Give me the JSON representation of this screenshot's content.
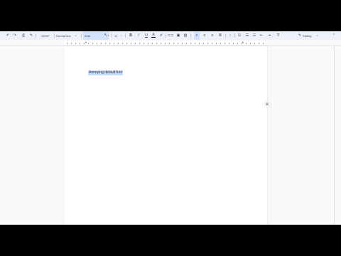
{
  "toolbar": {
    "zoom": "100%",
    "style": "Normal text",
    "font": "Arial",
    "font_size": "11",
    "editing_label": "Editing",
    "icons": [
      "undo-icon",
      "redo-icon",
      "print-icon",
      "paint-format-icon",
      "bold-icon",
      "italic-icon",
      "underline-icon",
      "text-color-icon",
      "highlight-icon",
      "link-icon",
      "add-comment-icon",
      "image-icon",
      "align-left-icon",
      "align-center-icon",
      "align-right-icon",
      "justify-icon",
      "line-spacing-icon",
      "checklist-icon",
      "bulleted-list-icon",
      "numbered-list-icon",
      "decrease-indent-icon",
      "increase-indent-icon",
      "clear-formatting-icon",
      "pencil-icon",
      "collapse-icon"
    ]
  },
  "document": {
    "selected_text": "Annoying default font"
  },
  "colors": {
    "toolbar_bg": "#edf2fa",
    "selection": "#c6dafc",
    "page": "#ffffff",
    "canvas": "#f8f9fa"
  }
}
